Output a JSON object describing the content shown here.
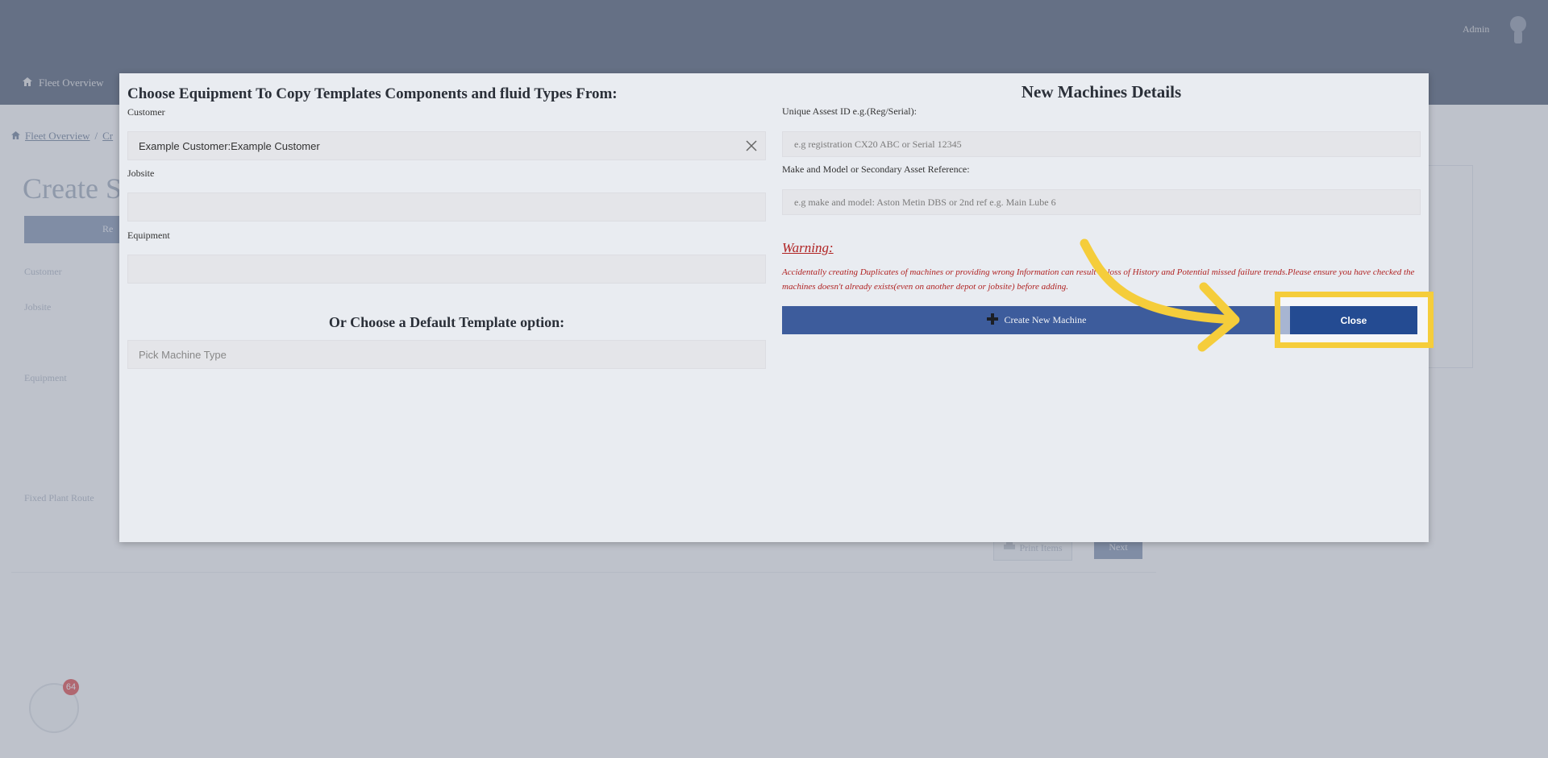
{
  "background": {
    "nav": {
      "fleet_overview": "Fleet Overview"
    },
    "user": {
      "name": "Admin"
    },
    "breadcrumb": {
      "home": "Fleet Overview",
      "current": "Cr"
    },
    "page_title": "Create S",
    "tab_label": "Re",
    "labels": {
      "customer": "Customer",
      "jobsite": "Jobsite",
      "equipment": "Equipment",
      "fixed_plant_route": "Fixed Plant Route"
    },
    "buttons": {
      "print": "Print Items",
      "next": "Next"
    },
    "widget_badge": "64"
  },
  "modal": {
    "left": {
      "heading": "Choose Equipment To Copy Templates Components and fluid Types From:",
      "customer_label": "Customer",
      "customer_value": "Example Customer:Example Customer",
      "jobsite_label": "Jobsite",
      "jobsite_value": "",
      "equipment_label": "Equipment",
      "equipment_value": "",
      "default_heading": "Or Choose a Default Template option:",
      "machine_type_placeholder": "Pick Machine Type"
    },
    "right": {
      "heading": "New Machines Details",
      "asset_id_label": "Unique Assest ID e.g.(Reg/Serial):",
      "asset_id_placeholder": "e.g registration CX20 ABC or Serial 12345",
      "make_model_label": "Make and Model or Secondary Asset Reference:",
      "make_model_placeholder": "e.g make and model: Aston Metin DBS or 2nd ref e.g. Main Lube 6",
      "warning_title": "Warning:",
      "warning_text": "Accidentally creating Duplicates of machines or providing wrong Information can result in loss of History and Potential missed failure trends.Please ensure you have checked the machines doesn't already exists(even on another depot or jobsite) before adding.",
      "create_button": "Create New Machine",
      "close_button": "Close"
    }
  },
  "colors": {
    "primary": "#3d5c9c",
    "close": "#244b92",
    "warning": "#b02323",
    "highlight": "#f5cd3b"
  },
  "icons": [
    "home-icon",
    "breadcrumb-home-icon",
    "user-avatar-icon",
    "clear-icon",
    "plus-icon",
    "print-icon",
    "arrow-annotation-icon"
  ]
}
